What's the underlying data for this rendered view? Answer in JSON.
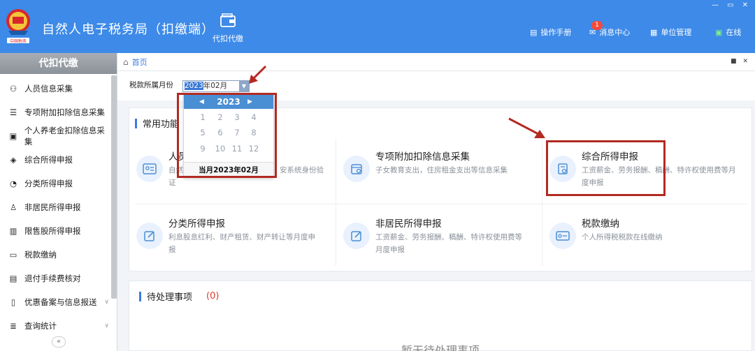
{
  "header": {
    "title": "自然人电子税务局（扣缴端）",
    "nav_item": "代扣代缴",
    "manual": "操作手册",
    "messages": "消息中心",
    "msg_badge": "1",
    "unit_mgmt": "单位管理",
    "online": "在线",
    "accent": "#3d8ae8"
  },
  "sidebar": {
    "title": "代扣代缴",
    "items": [
      {
        "label": "人员信息采集",
        "icon": "person-icon"
      },
      {
        "label": "专项附加扣除信息采集",
        "icon": "list-icon"
      },
      {
        "label": "个人养老金扣除信息采集",
        "icon": "pension-icon"
      },
      {
        "label": "综合所得申报",
        "icon": "layers-icon"
      },
      {
        "label": "分类所得申报",
        "icon": "pie-icon"
      },
      {
        "label": "非居民所得申报",
        "icon": "person-outline-icon"
      },
      {
        "label": "限售股所得申报",
        "icon": "bar-chart-icon"
      },
      {
        "label": "税款缴纳",
        "icon": "folder-icon"
      },
      {
        "label": "退付手续费核对",
        "icon": "document-icon"
      },
      {
        "label": "优惠备案与信息报送",
        "icon": "file-icon"
      },
      {
        "label": "查询统计",
        "icon": "query-icon"
      }
    ]
  },
  "breadcrumb": {
    "home": "首页"
  },
  "month": {
    "label": "税款所属月份",
    "value_sel": "2023",
    "value_rest": "年02月"
  },
  "calendar": {
    "year": "2023",
    "months": [
      "1",
      "2",
      "3",
      "4",
      "5",
      "6",
      "7",
      "8",
      "9",
      "10",
      "11",
      "12"
    ],
    "current": "当月2023年02月"
  },
  "common": {
    "title": "常用功能",
    "cards": [
      {
        "title": "人员",
        "desc1": "自然",
        "desc2": "证",
        "desc_tail": "安系统身份验"
      },
      {
        "title": "专项附加扣除信息采集",
        "desc1": "子女教育支出，住房租金支出等信息采集",
        "desc2": ""
      },
      {
        "title": "综合所得申报",
        "desc1": "工资薪金、劳务报酬、稿酬、特许权使用费等月",
        "desc2": "度申报"
      },
      {
        "title": "分类所得申报",
        "desc1": "利息股息红利、财产租赁、财产转让等月度申",
        "desc2": "报"
      },
      {
        "title": "非居民所得申报",
        "desc1": "工资薪金、劳务报酬、稿酬、特许权使用费等",
        "desc2": "月度申报"
      },
      {
        "title": "税款缴纳",
        "desc1": "个人所得税税款在线缴纳",
        "desc2": ""
      }
    ]
  },
  "pending": {
    "title": "待处理事项",
    "count": "(0)",
    "empty": "暂无待处理事项"
  }
}
